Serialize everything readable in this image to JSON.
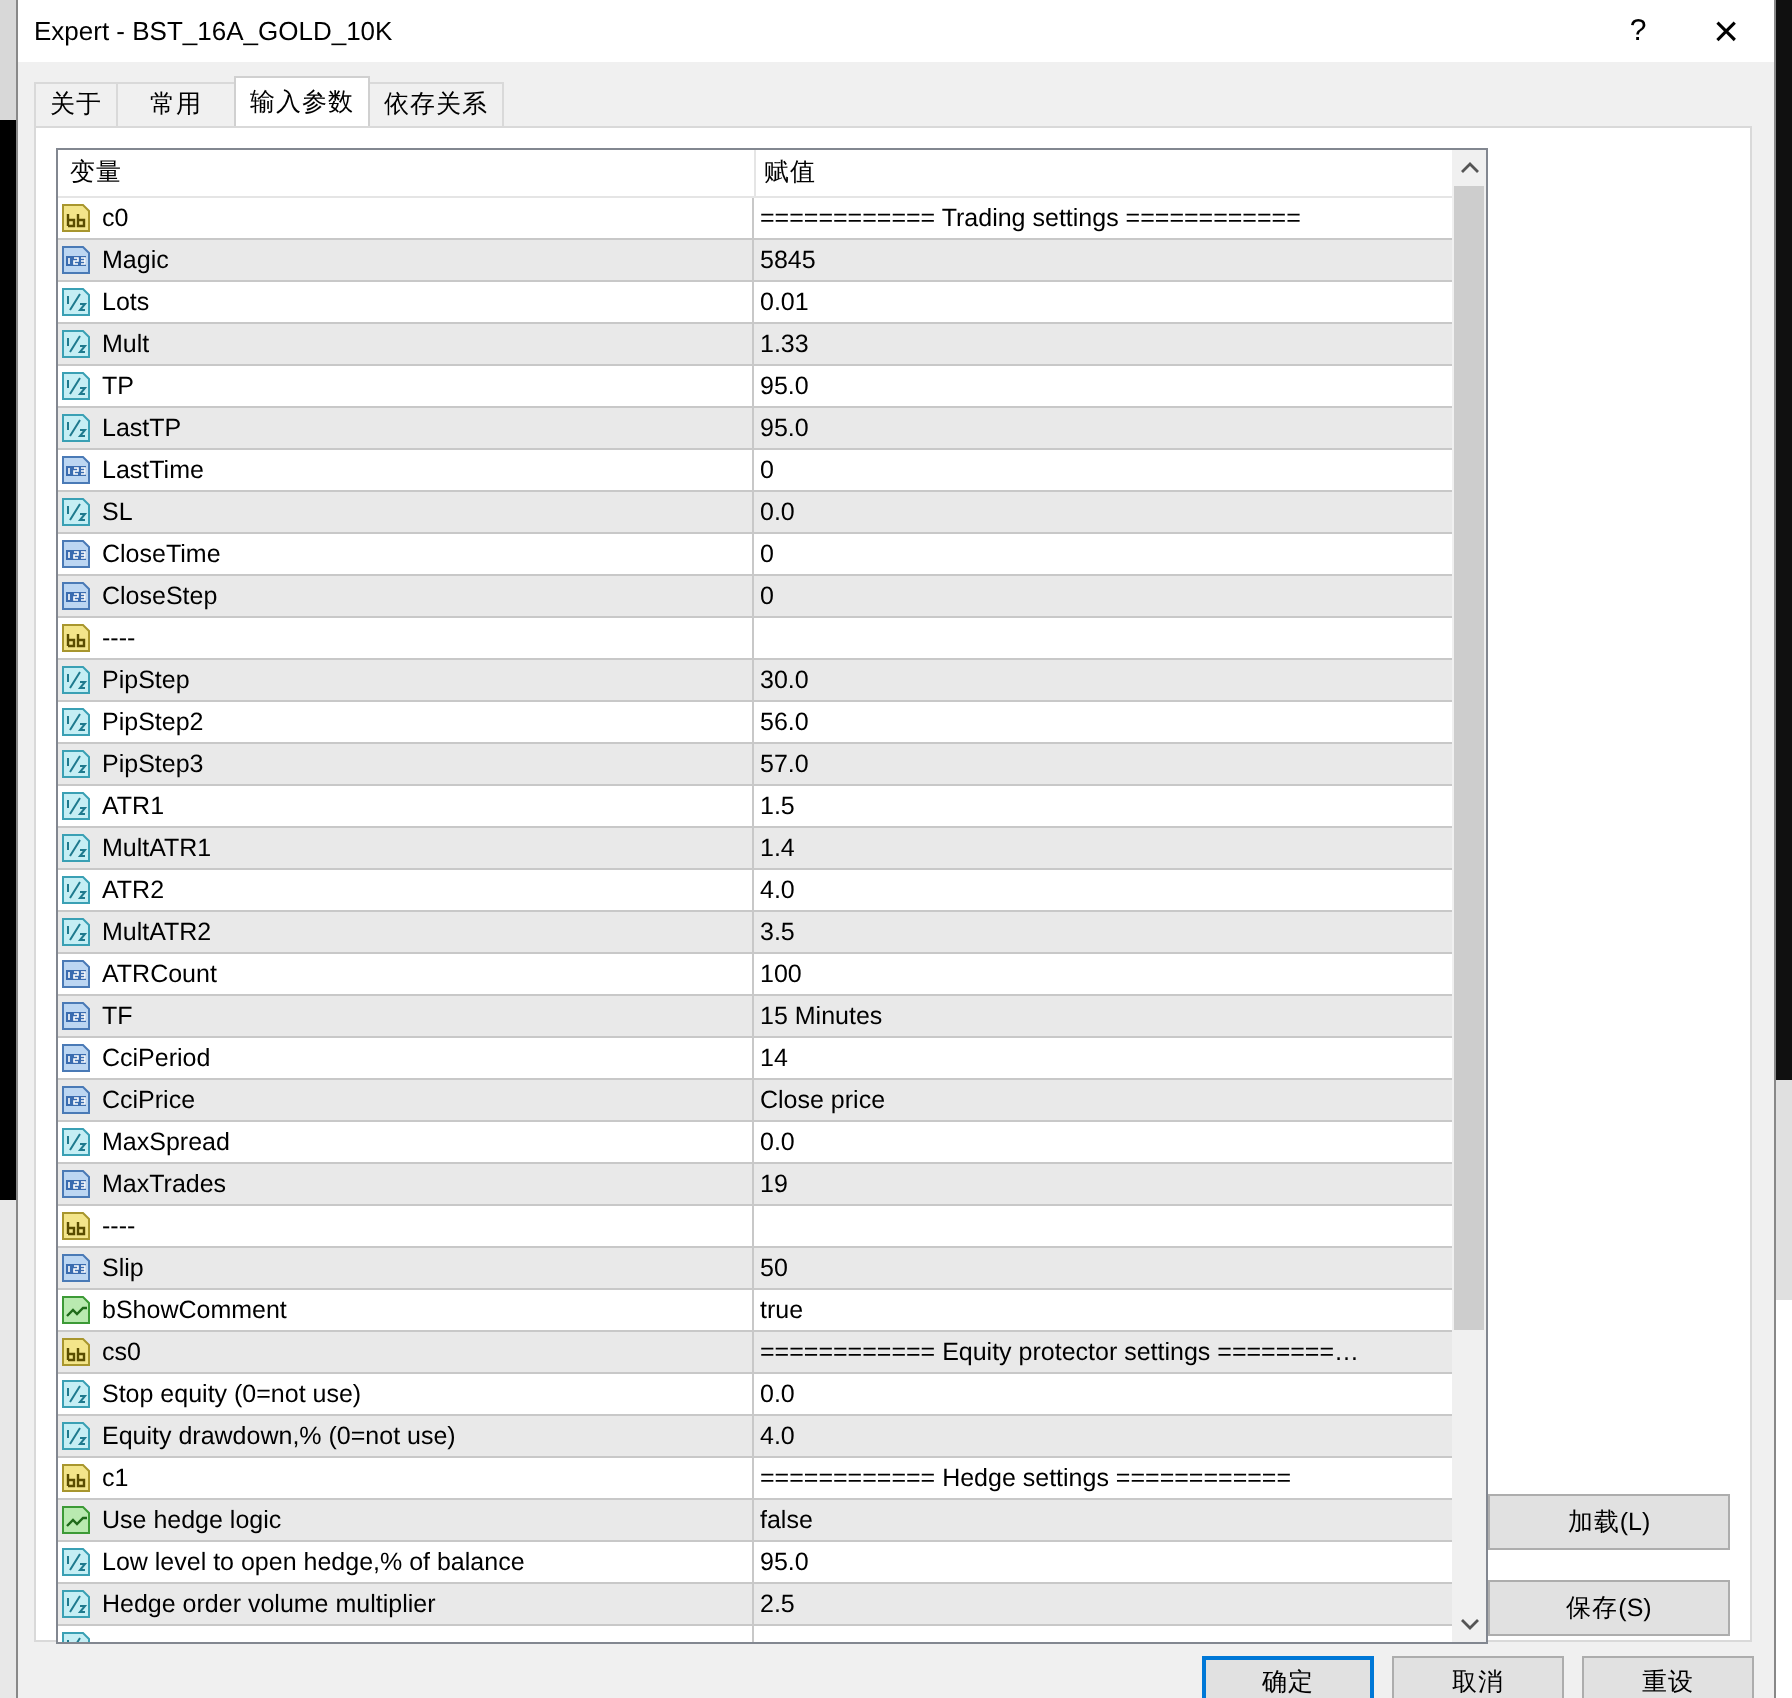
{
  "window": {
    "title": "Expert - BST_16A_GOLD_10K",
    "help": "?",
    "close": "×"
  },
  "tabs": [
    {
      "label": "关于",
      "selected": false
    },
    {
      "label": "常用",
      "selected": false
    },
    {
      "label": "输入参数",
      "selected": true
    },
    {
      "label": "依存关系",
      "selected": false
    }
  ],
  "table": {
    "columns": [
      "变量",
      "赋值"
    ],
    "rows": [
      {
        "kind": "string",
        "name": "c0",
        "value": "============ Trading settings ============"
      },
      {
        "kind": "int",
        "name": "Magic",
        "value": "5845"
      },
      {
        "kind": "double",
        "name": "Lots",
        "value": "0.01"
      },
      {
        "kind": "double",
        "name": "Mult",
        "value": "1.33"
      },
      {
        "kind": "double",
        "name": "TP",
        "value": "95.0"
      },
      {
        "kind": "double",
        "name": "LastTP",
        "value": "95.0"
      },
      {
        "kind": "int",
        "name": "LastTime",
        "value": "0"
      },
      {
        "kind": "double",
        "name": "SL",
        "value": "0.0"
      },
      {
        "kind": "int",
        "name": "CloseTime",
        "value": "0"
      },
      {
        "kind": "int",
        "name": "CloseStep",
        "value": "0"
      },
      {
        "kind": "string",
        "name": "----",
        "value": ""
      },
      {
        "kind": "double",
        "name": "PipStep",
        "value": "30.0"
      },
      {
        "kind": "double",
        "name": "PipStep2",
        "value": "56.0"
      },
      {
        "kind": "double",
        "name": "PipStep3",
        "value": "57.0"
      },
      {
        "kind": "double",
        "name": "ATR1",
        "value": "1.5"
      },
      {
        "kind": "double",
        "name": "MultATR1",
        "value": "1.4"
      },
      {
        "kind": "double",
        "name": "ATR2",
        "value": "4.0"
      },
      {
        "kind": "double",
        "name": "MultATR2",
        "value": "3.5"
      },
      {
        "kind": "int",
        "name": "ATRCount",
        "value": "100"
      },
      {
        "kind": "int",
        "name": "TF",
        "value": "15 Minutes"
      },
      {
        "kind": "int",
        "name": "CciPeriod",
        "value": "14"
      },
      {
        "kind": "int",
        "name": "CciPrice",
        "value": "Close price"
      },
      {
        "kind": "double",
        "name": "MaxSpread",
        "value": "0.0"
      },
      {
        "kind": "int",
        "name": "MaxTrades",
        "value": "19"
      },
      {
        "kind": "string",
        "name": "----",
        "value": ""
      },
      {
        "kind": "int",
        "name": "Slip",
        "value": "50"
      },
      {
        "kind": "bool",
        "name": "bShowComment",
        "value": "true"
      },
      {
        "kind": "string",
        "name": "cs0",
        "value": "============ Equity protector settings ========…"
      },
      {
        "kind": "double",
        "name": "Stop equity (0=not use)",
        "value": "0.0"
      },
      {
        "kind": "double",
        "name": "Equity drawdown,% (0=not use)",
        "value": "4.0"
      },
      {
        "kind": "string",
        "name": "c1",
        "value": "============ Hedge settings ============"
      },
      {
        "kind": "bool",
        "name": "Use hedge logic",
        "value": "false"
      },
      {
        "kind": "double",
        "name": "Low level to open hedge,% of balance",
        "value": "95.0"
      },
      {
        "kind": "double",
        "name": "Hedge order volume multiplier",
        "value": "2.5"
      },
      {
        "kind": "double"
      }
    ]
  },
  "side_buttons": [
    "加载(L)",
    "保存(S)"
  ],
  "buttons": [
    "确定",
    "取消",
    "重设"
  ]
}
